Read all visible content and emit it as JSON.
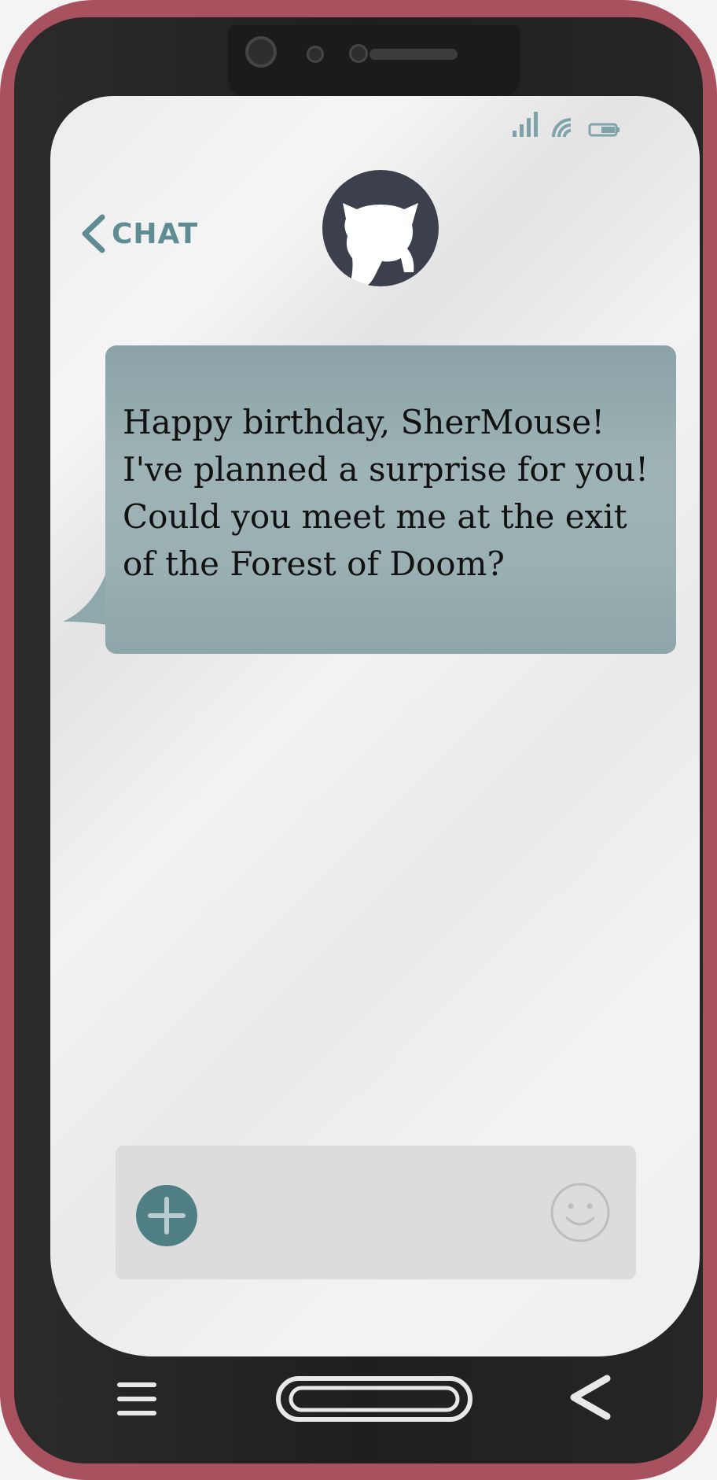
{
  "colors": {
    "frame": "#a8525f",
    "body": "#222222",
    "screen": "#efefef",
    "accent": "#5f8b93",
    "bubble": "#9ab0b3",
    "avatar": "#3c3f4c",
    "composer": "#dcdcdc"
  },
  "status_bar": {
    "icons": [
      "signal-icon",
      "wifi-icon",
      "battery-icon"
    ]
  },
  "header": {
    "back_label": "CHAT",
    "back_icon": "chevron-left-icon",
    "avatar_icon": "cat-silhouette-icon"
  },
  "conversation": {
    "messages": [
      {
        "text": "Happy birthday, SherMouse!\nI've planned a surprise for you!\nCould you meet me at the exit\nof the Forest of Doom?"
      }
    ]
  },
  "composer": {
    "add_icon": "plus-icon",
    "input_value": "",
    "input_placeholder": "",
    "emoji_icon": "smiley-icon"
  },
  "nav_bar": {
    "items": [
      "menu-icon",
      "home-icon",
      "back-icon"
    ]
  }
}
